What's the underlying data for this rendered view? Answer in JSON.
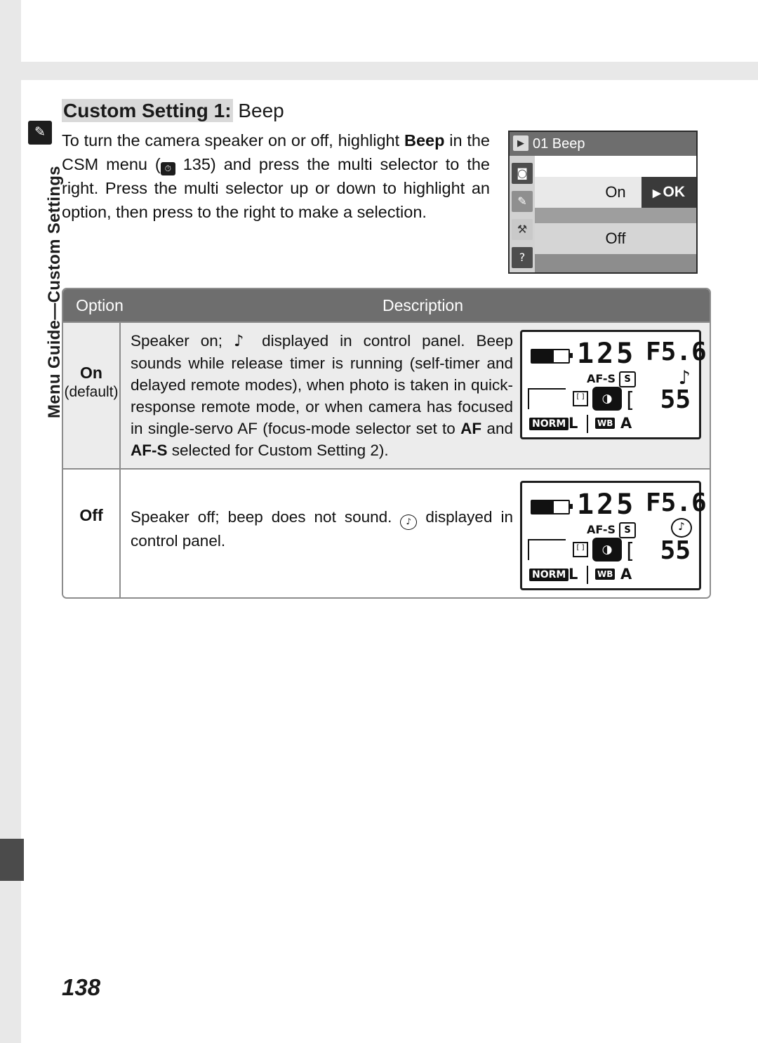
{
  "page": {
    "folio": "138",
    "running_head": "Menu Guide—Custom Settings",
    "running_head_icon": "✎"
  },
  "heading": {
    "highlight": "Custom Setting 1:",
    "rest": " Beep"
  },
  "intro": {
    "part1": "To turn the camera speaker on or off, highlight ",
    "bold": "Beep",
    "part2": " in the CSM menu (",
    "icon": "self-timer-icon",
    "part3": " 135) and press the multi selector to the right.  Press the multi selector up or down to highlight an option, then press to the right to make a selection."
  },
  "lcd_menu": {
    "title": "01 Beep",
    "play_icon": "▶",
    "sidebar_icons": [
      "camera-icon",
      "pencil-icon",
      "wrench-icon",
      "question-icon"
    ],
    "sidebar_glyphs": [
      "◙",
      "✎",
      "⚒",
      "?"
    ],
    "option_on": "On",
    "option_off": "Off",
    "ok_label": "OK",
    "ok_arrow": "▶"
  },
  "table": {
    "headers": {
      "option": "Option",
      "description": "Description"
    },
    "rows": [
      {
        "option_label": "On",
        "option_sub": "(default)",
        "description_pre": "Speaker on; ",
        "description_note_glyph": "♪",
        "description_mid": " displayed in control panel.  Beep sounds while release timer is running (self-timer and delayed remote modes), when photo is taken in quick-response remote mode, or when camera has focused in single-servo AF (focus-mode selector set to ",
        "description_bold1": "AF",
        "description_mid2": " and ",
        "description_bold2": "AF-S",
        "description_end": " selected for Custom Setting 2).",
        "control_panel": {
          "shutter": "125",
          "aperture": "F5.6",
          "af_mode": "AF-S",
          "af_box": "S",
          "beep_indicator": "♪",
          "frames": "55",
          "bracket": "[",
          "quality": "NORM",
          "image_size": "L",
          "wb_label": "WB",
          "wb_value": "A",
          "focus_bracket": "[ ]"
        }
      },
      {
        "option_label": "Off",
        "option_sub": "",
        "description_pre": "Speaker off; beep does not sound.  ",
        "description_note_glyph": "mute-icon",
        "description_mid": " displayed in control panel.",
        "control_panel": {
          "shutter": "125",
          "aperture": "F5.6",
          "af_mode": "AF-S",
          "af_box": "S",
          "beep_indicator": "mute-icon",
          "frames": "55",
          "bracket": "[",
          "quality": "NORM",
          "image_size": "L",
          "wb_label": "WB",
          "wb_value": "A",
          "focus_bracket": "[ ]"
        }
      }
    ]
  }
}
